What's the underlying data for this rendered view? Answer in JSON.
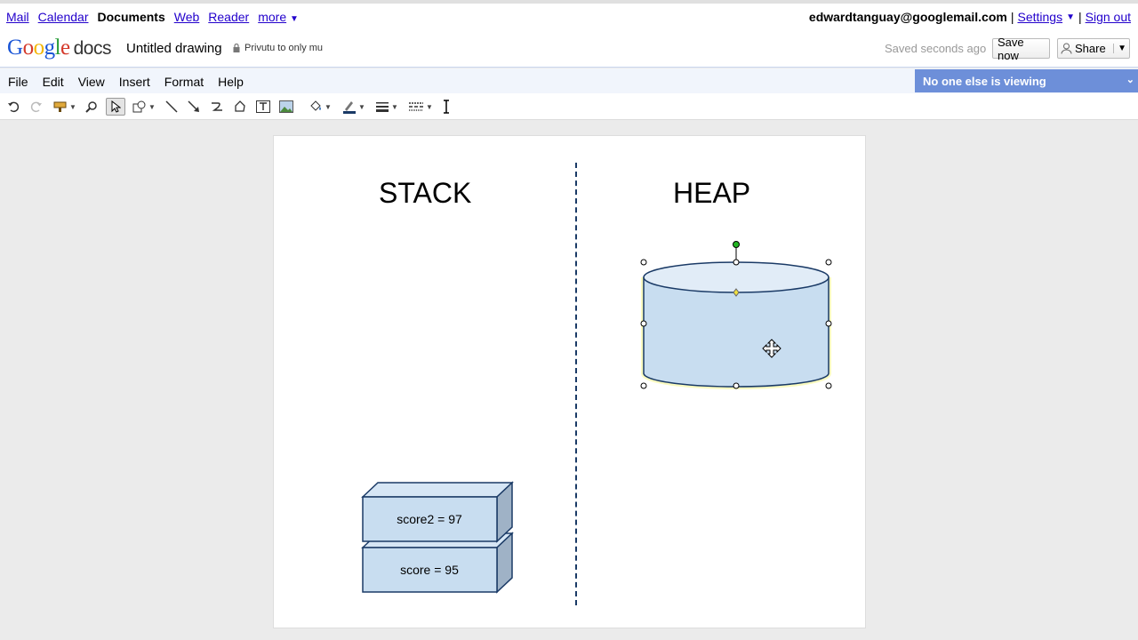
{
  "gbar": {
    "links": [
      "Mail",
      "Calendar",
      "Documents",
      "Web",
      "Reader",
      "more"
    ],
    "more_caret": "▼",
    "email": "edwardtanguay@googlemail.com",
    "settings": "Settings",
    "settings_caret": "▼",
    "sep": "|",
    "signout": "Sign out"
  },
  "header": {
    "doc_title": "Untitled drawing",
    "privacy": "Privutu to only mu",
    "saved": "Saved seconds ago",
    "save_now": "Save now",
    "share": "Share"
  },
  "menu": [
    "File",
    "Edit",
    "View",
    "Insert",
    "Format",
    "Help"
  ],
  "viewing": "No one else is viewing",
  "toolbar": {
    "icons": [
      "undo-icon",
      "redo-icon",
      "paint-format-icon",
      "zoom-icon",
      "select-icon",
      "shape-icon",
      "line-icon",
      "arrow-icon",
      "curve-icon",
      "polyline-icon",
      "textbox-icon",
      "image-icon",
      "fill-color-icon",
      "line-color-icon",
      "line-weight-icon",
      "line-dash-icon",
      "text-cursor-icon"
    ]
  },
  "drawing": {
    "stack_title": "STACK",
    "heap_title": "HEAP",
    "boxes": [
      "score2 = 97",
      "score = 95"
    ]
  },
  "colors": {
    "link": "#2200cc",
    "viewing_bg": "#6d8fd9",
    "box_fill": "#c8ddf0",
    "box_stroke": "#1a3a66"
  }
}
